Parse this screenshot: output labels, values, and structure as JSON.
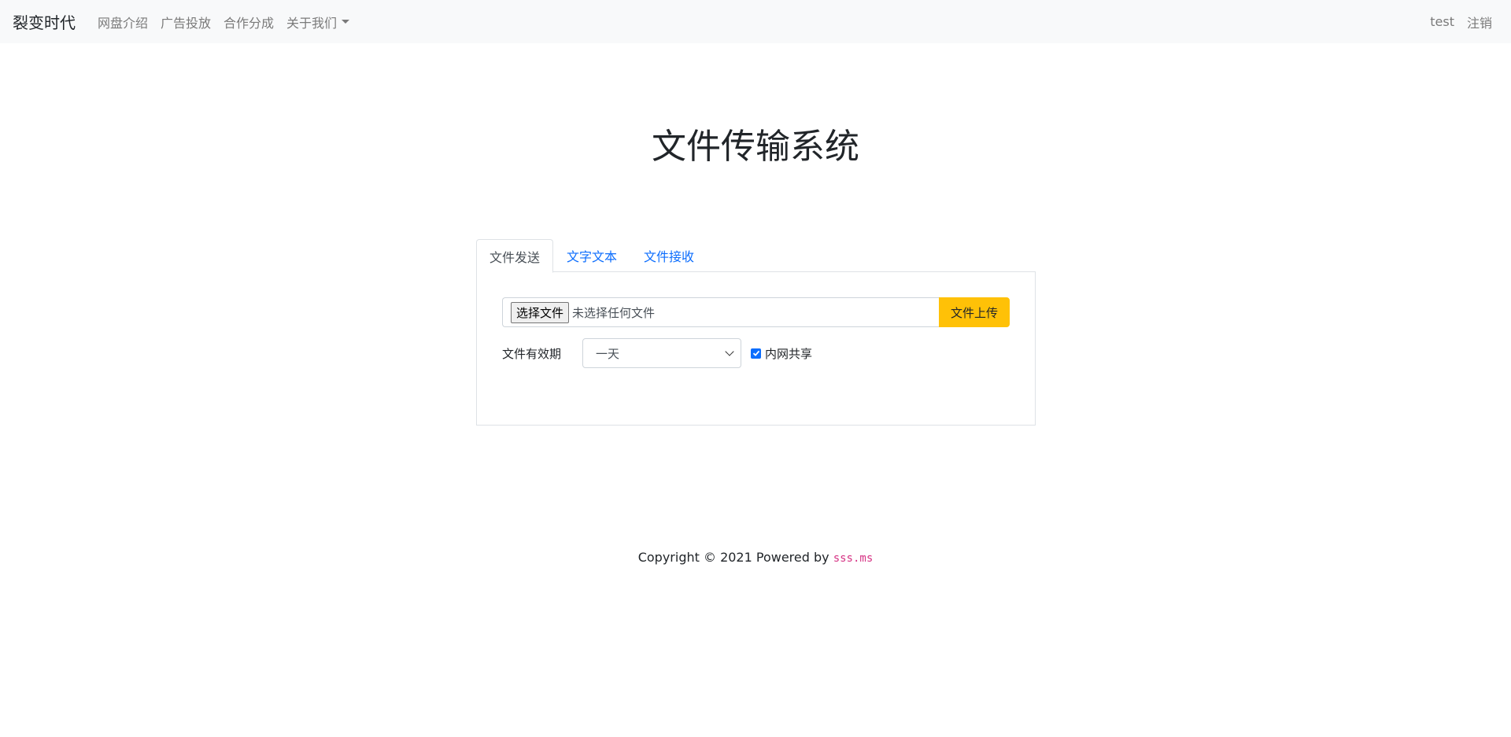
{
  "navbar": {
    "brand": "裂变时代",
    "links": [
      "网盘介绍",
      "广告投放",
      "合作分成",
      "关于我们"
    ],
    "user": "test",
    "logout": "注销"
  },
  "main": {
    "title": "文件传输系统",
    "tabs": [
      "文件发送",
      "文字文本",
      "文件接收"
    ],
    "active_tab": 0,
    "file_input": {
      "button_label": "选择文件",
      "status": "未选择任何文件"
    },
    "upload_button": "文件上传",
    "expiry": {
      "label": "文件有效期",
      "selected": "一天"
    },
    "intranet_share": {
      "label": "内网共享",
      "checked": true
    }
  },
  "footer": {
    "prefix": "Copyright © 2021 Powered by ",
    "link": "sss.ms"
  },
  "colors": {
    "navbar_bg": "#f8f9fa",
    "link": "#0d6efd",
    "upload_button": "#ffc107",
    "checkbox": "#0d6efd",
    "footer_code": "#d63384"
  }
}
